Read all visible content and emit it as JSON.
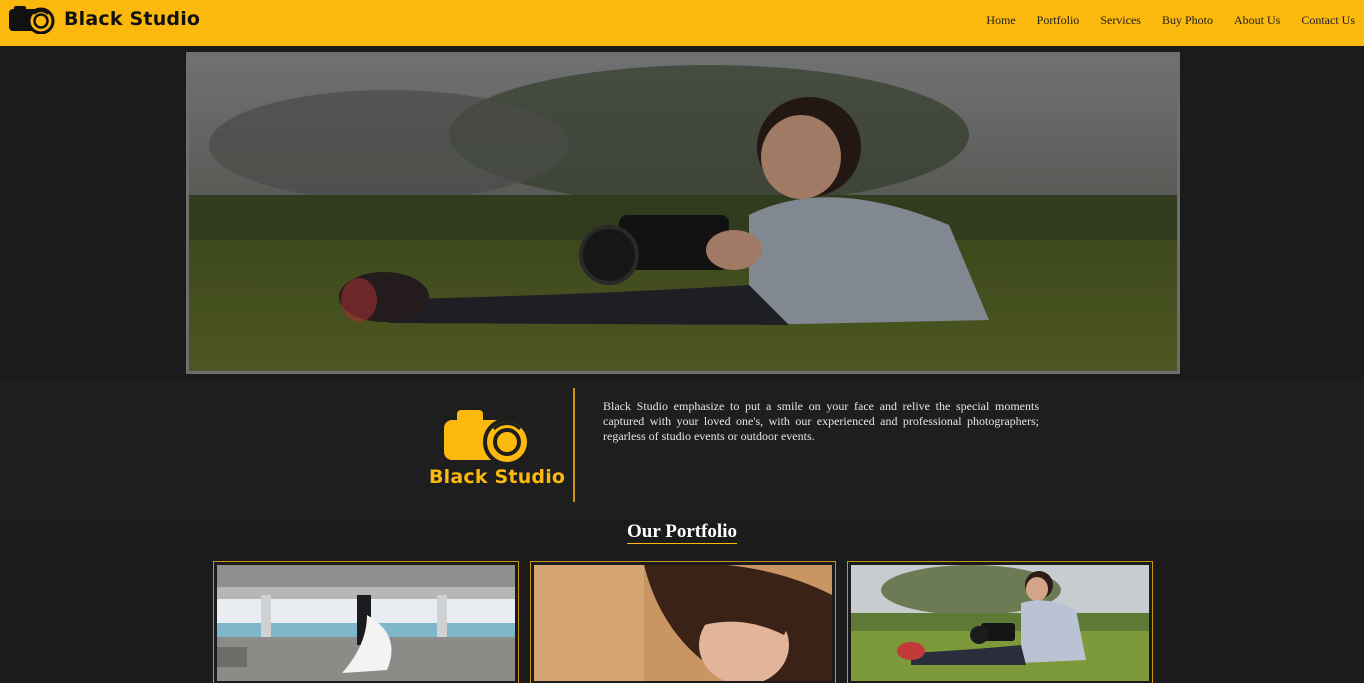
{
  "brand": {
    "name": "Black Studio"
  },
  "nav": {
    "items": [
      {
        "label": "Home"
      },
      {
        "label": "Portfolio"
      },
      {
        "label": "Services"
      },
      {
        "label": "Buy Photo"
      },
      {
        "label": "About Us"
      },
      {
        "label": "Contact Us"
      }
    ]
  },
  "hero": {
    "image": "child-with-camera-on-grass-photo"
  },
  "about": {
    "logo_text": "Black Studio",
    "description": "Black Studio emphasize to put a smile on your face and relive the special moments captured with your loved one's, with our experienced and professional photographers; regarless of studio events or outdoor events."
  },
  "portfolio": {
    "title": "Our Portfolio",
    "items": [
      {
        "image": "wedding-couple-gazebo-photo"
      },
      {
        "image": "girl-portrait-photo"
      },
      {
        "image": "child-with-camera-photo"
      }
    ]
  },
  "colors": {
    "accent": "#fbb80d",
    "background": "#1b1b1b",
    "border": "#c9950f"
  }
}
